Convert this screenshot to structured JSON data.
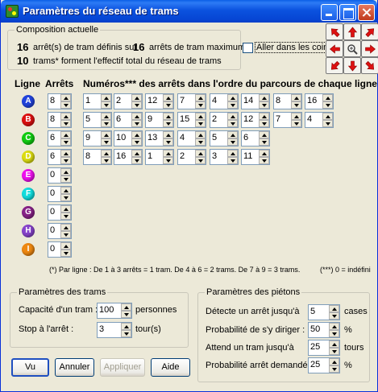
{
  "window": {
    "title": "Paramètres du réseau de trams"
  },
  "composition": {
    "title": "Composition actuelle",
    "line1_count": "16",
    "line1_text_a": "arrêt(s) de tram définis sur",
    "line1_max": "16",
    "line1_text_b": "arrêts de tram maximum",
    "line2_count": "10",
    "line2_text": "trams* forment l'effectif total du réseau de trams"
  },
  "corners_checkbox": {
    "label": "Aller dans les coins",
    "checked": false
  },
  "nav_icons": [
    "arrow-up-left-icon",
    "arrow-up-icon",
    "arrow-up-right-icon",
    "arrow-left-icon",
    "zoom-icon",
    "arrow-right-icon",
    "arrow-down-left-icon",
    "arrow-down-icon",
    "arrow-down-right-icon"
  ],
  "table": {
    "col_line": "Ligne",
    "col_stops": "Arrêts",
    "col_numbers": "Numéros*** des arrêts dans l'ordre du parcours de chaque ligne",
    "lines": [
      {
        "letter": "A",
        "color": "#2244dd",
        "stops": "8",
        "numbers": [
          "1",
          "2",
          "12",
          "7",
          "4",
          "14",
          "8",
          "16"
        ]
      },
      {
        "letter": "B",
        "color": "#dd1111",
        "stops": "8",
        "numbers": [
          "5",
          "6",
          "9",
          "15",
          "2",
          "12",
          "7",
          "4"
        ]
      },
      {
        "letter": "C",
        "color": "#11cc11",
        "stops": "6",
        "numbers": [
          "9",
          "10",
          "13",
          "4",
          "5",
          "6"
        ]
      },
      {
        "letter": "D",
        "color": "#dddd11",
        "stops": "6",
        "numbers": [
          "8",
          "16",
          "1",
          "2",
          "3",
          "11"
        ]
      },
      {
        "letter": "E",
        "color": "#ee11ee",
        "stops": "0",
        "numbers": []
      },
      {
        "letter": "F",
        "color": "#11dddd",
        "stops": "0",
        "numbers": []
      },
      {
        "letter": "G",
        "color": "#882288",
        "stops": "0",
        "numbers": []
      },
      {
        "letter": "H",
        "color": "#8844cc",
        "stops": "0",
        "numbers": []
      },
      {
        "letter": "I",
        "color": "#ee8811",
        "stops": "0",
        "numbers": []
      }
    ],
    "note_left": "(*) Par ligne : De 1 à 3 arrêts = 1 tram. De 4 à 6 = 2 trams. De 7 à 9 = 3 trams.",
    "note_right": "(***) 0 = indéfini"
  },
  "trams": {
    "title": "Paramètres des trams",
    "capacity_label": "Capacité d'un tram :",
    "capacity_value": "100",
    "capacity_unit": "personnes",
    "stop_label": "Stop à l'arrêt :",
    "stop_value": "3",
    "stop_unit": "tour(s)"
  },
  "pedestrians": {
    "title": "Paramètres des piétons",
    "detect_label": "Détecte un arrêt jusqu'à",
    "detect_value": "5",
    "detect_unit": "cases",
    "prob_go_label": "Probabilité de s'y diriger :",
    "prob_go_value": "50",
    "prob_go_unit": "%",
    "wait_label": "Attend un tram jusqu'à",
    "wait_value": "25",
    "wait_unit": "tours",
    "prob_stop_label": "Probabilité arrêt demandé :",
    "prob_stop_value": "25",
    "prob_stop_unit": "%"
  },
  "buttons": {
    "ok": "Vu",
    "cancel": "Annuler",
    "apply": "Appliquer",
    "help": "Aide"
  }
}
